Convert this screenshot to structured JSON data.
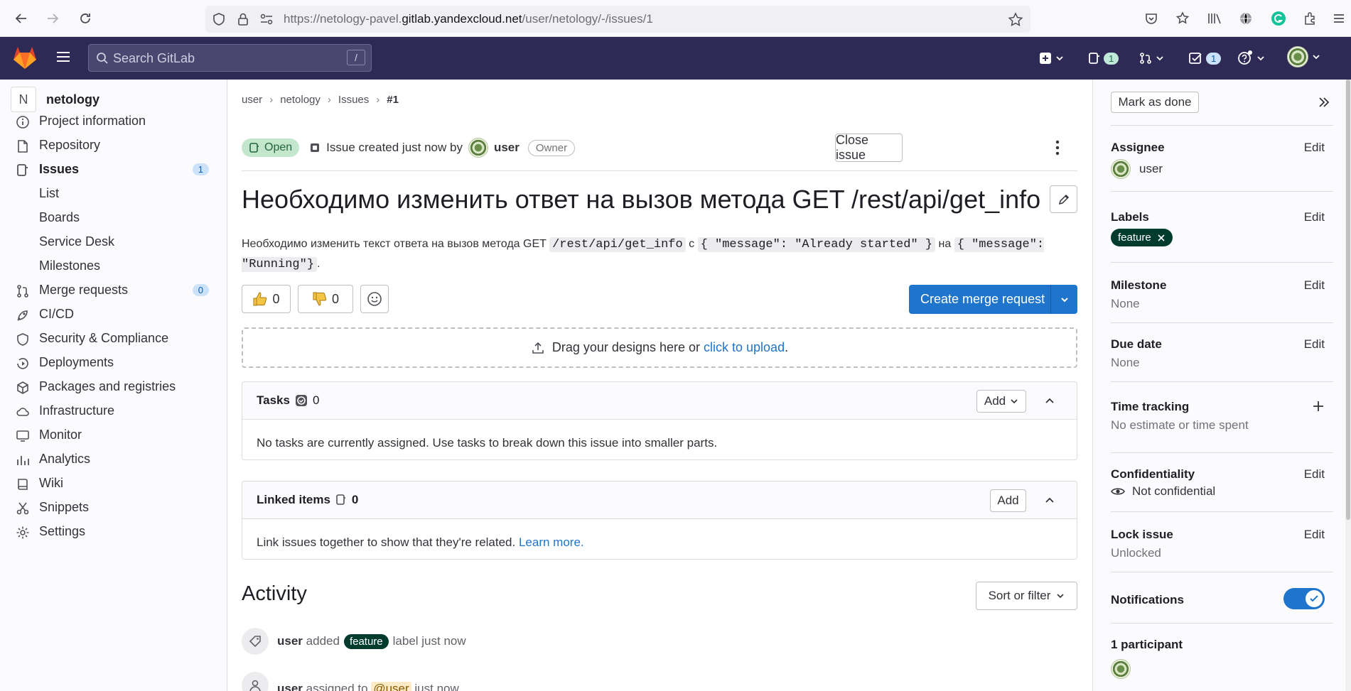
{
  "browser": {
    "url_prefix": "https://netology-pavel.",
    "url_domain": "gitlab.yandexcloud.net",
    "url_path": "/user/netology/-/issues/1"
  },
  "topbar": {
    "search_placeholder": "Search GitLab",
    "search_shortcut": "/",
    "issues_count": "1",
    "todos_count": "1"
  },
  "sidebar": {
    "project_initial": "N",
    "project_name": "netology",
    "items": [
      {
        "label": "Project information",
        "icon": "info-icon"
      },
      {
        "label": "Repository",
        "icon": "doc-icon"
      },
      {
        "label": "Issues",
        "icon": "issues-icon",
        "count": "1"
      },
      {
        "label": "List"
      },
      {
        "label": "Boards"
      },
      {
        "label": "Service Desk"
      },
      {
        "label": "Milestones"
      },
      {
        "label": "Merge requests",
        "icon": "merge-request-icon",
        "count": "0"
      },
      {
        "label": "CI/CD",
        "icon": "rocket-icon"
      },
      {
        "label": "Security & Compliance",
        "icon": "shield-icon"
      },
      {
        "label": "Deployments",
        "icon": "deployments-icon"
      },
      {
        "label": "Packages and registries",
        "icon": "package-icon"
      },
      {
        "label": "Infrastructure",
        "icon": "cloud-icon"
      },
      {
        "label": "Monitor",
        "icon": "monitor-icon"
      },
      {
        "label": "Analytics",
        "icon": "chart-icon"
      },
      {
        "label": "Wiki",
        "icon": "book-icon"
      },
      {
        "label": "Snippets",
        "icon": "scissors-icon"
      },
      {
        "label": "Settings",
        "icon": "gear-icon"
      }
    ]
  },
  "breadcrumb": [
    "user",
    "netology",
    "Issues",
    "#1"
  ],
  "issue": {
    "status": "Open",
    "created_text": "Issue created just now by",
    "author": "user",
    "author_role": "Owner",
    "close_label": "Close issue",
    "title": "Необходимо изменить ответ на вызов метода GET /rest/api/get_info",
    "desc_1": "Необходимо изменить текст ответа на вызов метода GET",
    "desc_code_1": "/rest/api/get_info",
    "desc_2": "с",
    "desc_code_2": "{ \"message\": \"Already started\" }",
    "desc_3": "на",
    "desc_code_3": "{ \"message\": \"Running\"}",
    "desc_4": ".",
    "thumbs_up": "0",
    "thumbs_down": "0",
    "create_mr_label": "Create merge request",
    "drop_text": "Drag your designs here or",
    "drop_link": "click to upload",
    "drop_end": "."
  },
  "tasks": {
    "title": "Tasks",
    "count": "0",
    "add_label": "Add",
    "empty_text": "No tasks are currently assigned. Use tasks to break down this issue into smaller parts."
  },
  "linked": {
    "title": "Linked items",
    "count": "0",
    "add_label": "Add",
    "text": "Link issues together to show that they're related.",
    "link": "Learn more."
  },
  "activity": {
    "title": "Activity",
    "sort_label": "Sort or filter",
    "note1_user": "user",
    "note1_text_a": "added",
    "note1_label": "feature",
    "note1_text_b": "label just now",
    "note2_user": "user",
    "note2_text_a": "assigned to",
    "note2_mention": "@user",
    "note2_text_b": "just now"
  },
  "right": {
    "mark_done": "Mark as done",
    "assignee_h": "Assignee",
    "assignee": "user",
    "labels_h": "Labels",
    "label": "feature",
    "milestone_h": "Milestone",
    "milestone": "None",
    "due_h": "Due date",
    "due": "None",
    "time_h": "Time tracking",
    "time": "No estimate or time spent",
    "conf_h": "Confidentiality",
    "conf": "Not confidential",
    "lock_h": "Lock issue",
    "lock": "Unlocked",
    "notif_h": "Notifications",
    "participants": "1 participant",
    "edit": "Edit"
  },
  "colors": {
    "accent": "#1f75cb",
    "topbar": "#2e2a55",
    "label": "#003c2e",
    "open": "#c3e6cd"
  }
}
